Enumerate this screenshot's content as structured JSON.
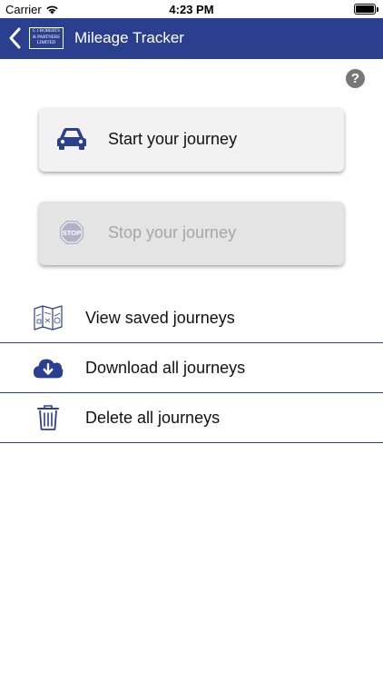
{
  "status_bar": {
    "carrier": "Carrier",
    "time": "4:23 PM"
  },
  "nav": {
    "title": "Mileage Tracker",
    "logo_lines": [
      "C J ROBERTS",
      "& PARTNERS",
      "LIMITED"
    ]
  },
  "help": {
    "glyph": "?"
  },
  "cards": {
    "start_label": "Start your journey",
    "stop_label": "Stop your journey",
    "stop_sign_text": "STOP"
  },
  "list": {
    "view_label": "View saved journeys",
    "download_label": "Download all journeys",
    "delete_label": "Delete all journeys"
  },
  "colors": {
    "brand": "#2b3f8f",
    "card_active_bg": "#f2f2f2",
    "card_disabled_bg": "#e4e4e4",
    "disabled_text": "#a6a6a6",
    "help_gray": "#777777"
  },
  "icons": {
    "wifi": "wifi-icon",
    "battery": "battery-icon",
    "back": "chevron-left-icon",
    "car": "car-icon",
    "stop": "stop-sign-icon",
    "map": "map-icon",
    "download": "cloud-download-icon",
    "delete": "trash-icon",
    "help": "question-mark-icon"
  }
}
